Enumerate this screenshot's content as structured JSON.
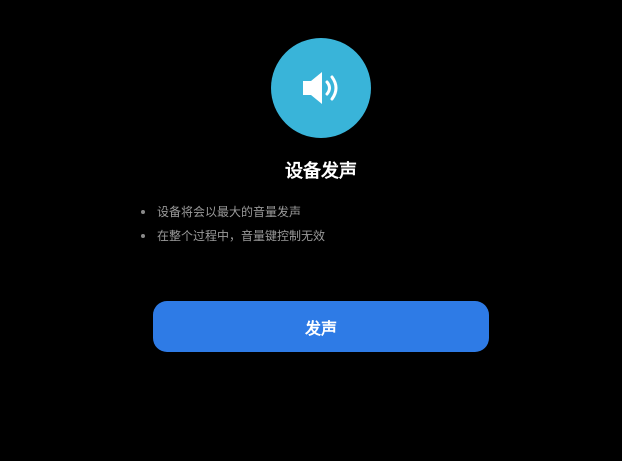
{
  "header": {
    "icon": "speaker-sound-icon",
    "icon_bg_color": "#39b4d9",
    "title": "设备发声"
  },
  "notes": [
    "设备将会以最大的音量发声",
    "在整个过程中，音量键控制无效"
  ],
  "action": {
    "button_label": "发声",
    "button_color": "#2e7be6"
  }
}
